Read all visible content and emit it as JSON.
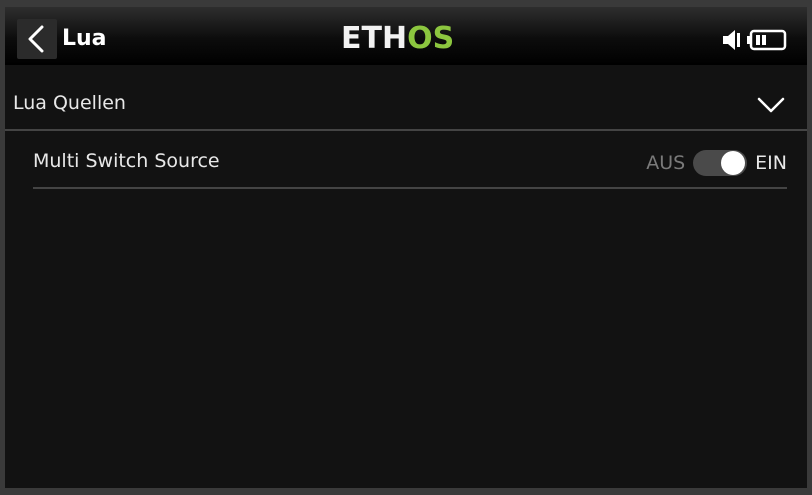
{
  "header": {
    "back_icon": "chevron-left-icon",
    "title": "Lua",
    "logo_text_white": "ETH",
    "logo_text_green": "OS",
    "logo_green_color": "#8cc63f",
    "speaker_icon": "speaker-icon",
    "battery_icon": "battery-icon"
  },
  "section": {
    "label": "Lua Quellen",
    "expand_icon": "chevron-down-icon",
    "expanded": true
  },
  "option": {
    "label": "Multi Switch Source",
    "off_label": "AUS",
    "on_label": "EIN",
    "enabled": true
  }
}
